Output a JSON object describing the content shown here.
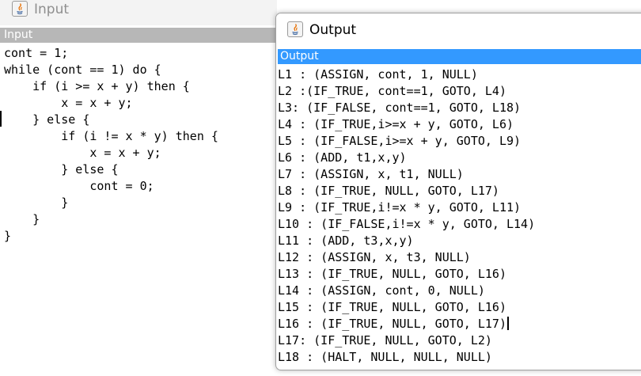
{
  "input_window": {
    "title": "Input",
    "panel_header": "Input",
    "code": "cont = 1;\nwhile (cont == 1) do {\n    if (i >= x + y) then {\n        x = x + y;\n    } else {\n        if (i != x * y) then {\n            x = x + y;\n        } else {\n            cont = 0;\n        }\n    }\n}"
  },
  "output_window": {
    "title": "Output",
    "panel_header": "Output",
    "code": "L1 : (ASSIGN, cont, 1, NULL)\nL2 :(IF_TRUE, cont==1, GOTO, L4)\nL3: (IF_FALSE, cont==1, GOTO, L18)\nL4 : (IF_TRUE,i>=x + y, GOTO, L6)\nL5 : (IF_FALSE,i>=x + y, GOTO, L9)\nL6 : (ADD, t1,x,y)\nL7 : (ASSIGN, x, t1, NULL)\nL8 : (IF_TRUE, NULL, GOTO, L17)\nL9 : (IF_TRUE,i!=x * y, GOTO, L11)\nL10 : (IF_FALSE,i!=x * y, GOTO, L14)\nL11 : (ADD, t3,x,y)\nL12 : (ASSIGN, x, t3, NULL)\nL13 : (IF_TRUE, NULL, GOTO, L16)\nL14 : (ASSIGN, cont, 0, NULL)\nL15 : (IF_TRUE, NULL, GOTO, L16)\nL16 : (IF_TRUE, NULL, GOTO, L17)\nL17: (IF_TRUE, NULL, GOTO, L2)\nL18 : (HALT, NULL, NULL, NULL)"
  },
  "icons": {
    "window_icon": "java-app-icon"
  },
  "colors": {
    "output_header_bg": "#3399ff",
    "input_header_bg": "#b7b7b7"
  }
}
